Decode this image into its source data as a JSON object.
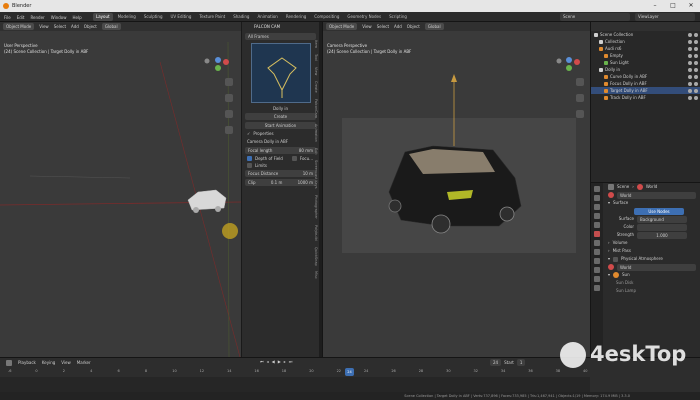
{
  "window": {
    "title": "Blender"
  },
  "menu": [
    "File",
    "Edit",
    "Render",
    "Window",
    "Help"
  ],
  "workspaces": [
    "Layout",
    "Modeling",
    "Sculpting",
    "UV Editing",
    "Texture Paint",
    "Shading",
    "Animation",
    "Rendering",
    "Compositing",
    "Geometry Nodes",
    "Scripting"
  ],
  "active_workspace": "Layout",
  "scene_name": "Scene",
  "view_layer": "ViewLayer",
  "left_viewport": {
    "mode": "Object Mode",
    "menu": [
      "View",
      "Select",
      "Add",
      "Object"
    ],
    "transform": "Global",
    "perspective": "User Perspective",
    "collection_path": "(24) Scene Collection | Target Dolly in ABF"
  },
  "falcon_panel": {
    "title": "FALCON CAM",
    "preset": "All Frames",
    "caption": "Dolly in",
    "create_label": "Create",
    "start_label": "Start Animation",
    "properties_label": "Properties",
    "camera_name": "Camera Dolly in ABF",
    "focal_label": "Focal length",
    "focal_value": "80 mm",
    "dof_label": "Depth of Field",
    "focus_label": "Focu...",
    "limits_label": "Limits",
    "focus_distance_label": "Focus Distance",
    "focus_distance_value": "10 m",
    "clip_label": "Clip",
    "clip_start": "0.1 m",
    "clip_end": "1000 m"
  },
  "vertical_tabs": [
    "Item",
    "Tool",
    "View",
    "Create",
    "FalconCam",
    "Animation",
    "Edit",
    "Screencast Keys",
    "Photographer",
    "Polybuild",
    "QuickSnap",
    "Misc"
  ],
  "right_viewport": {
    "mode": "Object Mode",
    "menu": [
      "View",
      "Select",
      "Add",
      "Object"
    ],
    "transform": "Global",
    "perspective": "Camera Perspective",
    "collection_path": "(24) Scene Collection | Target Dolly in ABF"
  },
  "outliner": {
    "items": [
      {
        "label": "Scene Collection",
        "indent": 0,
        "icon": "collection-icon",
        "selected": false
      },
      {
        "label": "Collection",
        "indent": 1,
        "icon": "collection-icon",
        "selected": false
      },
      {
        "label": "Audi rs6",
        "indent": 1,
        "icon": "object-icon",
        "selected": false
      },
      {
        "label": "Empty",
        "indent": 2,
        "icon": "empty-icon",
        "selected": false
      },
      {
        "label": "Sun Light",
        "indent": 2,
        "icon": "light-icon",
        "selected": false
      },
      {
        "label": "Dolly in",
        "indent": 1,
        "icon": "collection-icon",
        "selected": false
      },
      {
        "label": "Curve Dolly in ABF",
        "indent": 2,
        "icon": "curve-icon",
        "selected": false
      },
      {
        "label": "Focus Dolly in ABF",
        "indent": 2,
        "icon": "empty-icon",
        "selected": false
      },
      {
        "label": "Target Dolly in ABF",
        "indent": 2,
        "icon": "empty-icon",
        "selected": true
      },
      {
        "label": "Track Dolly in ABF",
        "indent": 2,
        "icon": "curve-icon",
        "selected": false
      }
    ]
  },
  "properties": {
    "context_scene": "Scene",
    "context_world": "World",
    "world_name": "World",
    "surface_label": "Surface",
    "use_nodes_label": "Use Nodes",
    "surface_field_label": "Surface",
    "surface_value": "Background",
    "color_label": "Color",
    "strength_label": "Strength",
    "strength_value": "1.000",
    "volume_label": "Volume",
    "mist_label": "Mist Pass",
    "atmosphere_label": "Physical Atmosphere",
    "atmosphere_world": "World",
    "sun_label": "Sun",
    "sun_sub1": "Sun Disk",
    "sun_sub2": "Sun Lamp"
  },
  "timeline": {
    "menu": [
      "Playback",
      "Keying",
      "View",
      "Marker"
    ],
    "ticks": [
      "-6",
      "0",
      "2",
      "4",
      "6",
      "8",
      "10",
      "12",
      "14",
      "16",
      "18",
      "20",
      "22",
      "24",
      "26",
      "28",
      "30",
      "32",
      "34",
      "36",
      "38",
      "40"
    ],
    "current_frame": "24",
    "start_label": "Start",
    "start_value": "1"
  },
  "status": {
    "text": "Scene Collection | Target Dolly in ABF | Verts:737,896 | Faces:733,985 | Tris:1,467,941 | Objects:1/19 | Memory: 174.9 MiB | 3.3.0"
  },
  "watermark": {
    "text": "4eskTop"
  },
  "colors": {
    "accent": "#3d6fb3",
    "selection": "#334d7a",
    "orange": "#e08a2e"
  }
}
